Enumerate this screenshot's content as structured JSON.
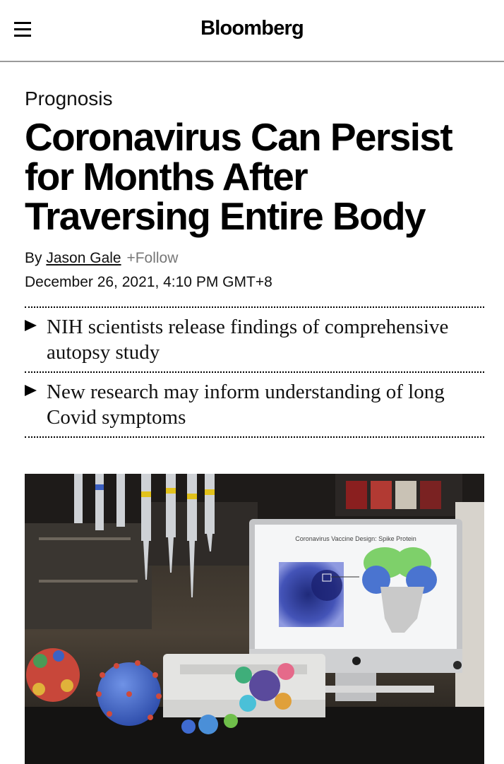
{
  "header": {
    "logo": "Bloomberg",
    "menu_icon": "hamburger-menu-icon"
  },
  "article": {
    "section": "Prognosis",
    "headline": "Coronavirus Can Persist for Months After Traversing Entire Body",
    "byline_prefix": "By",
    "author": "Jason Gale",
    "follow_label": "+Follow",
    "date": "December 26, 2021, 4:10 PM GMT+8",
    "bullets": [
      "NIH scientists release findings of comprehensive autopsy study",
      "New research may inform understanding of long Covid symptoms"
    ]
  },
  "hero_image": {
    "screen_title": "Coronavirus Vaccine Design: Spike Protein",
    "colors": {
      "spike_green": "#7ed06a",
      "spike_blue": "#4a74d0",
      "spike_gray": "#c9c9c9",
      "virus_blue": "#3d62c2",
      "virus_red": "#c8473a"
    }
  }
}
